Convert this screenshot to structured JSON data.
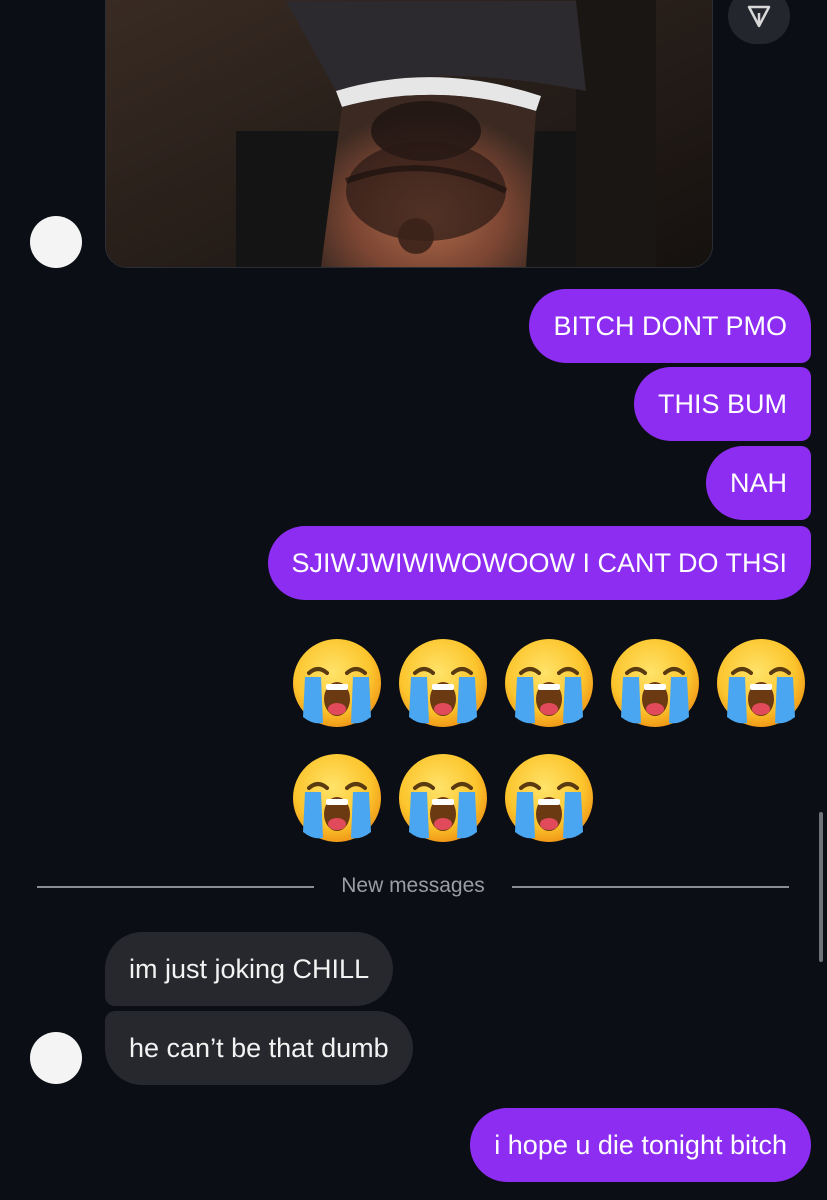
{
  "thread": {
    "shared_photo": {
      "description_icon": "share-icon"
    },
    "outgoing_group_1": [
      "BITCH DONT PMO",
      "THIS BUM",
      "NAH",
      "SJIWJWIWIWOWOOW I CANT DO THSI"
    ],
    "emoji_reaction": {
      "glyph": "loudly-crying-face",
      "count": 8
    },
    "divider_label": "New messages",
    "incoming_group": [
      "im just joking CHILL",
      "he can’t be that dumb"
    ],
    "outgoing_last": "i hope u die tonight bitch"
  },
  "colors": {
    "background": "#0b0e14",
    "outgoing_bubble": "#8d2df2",
    "incoming_bubble": "#26282d",
    "divider": "#8a8d93"
  }
}
